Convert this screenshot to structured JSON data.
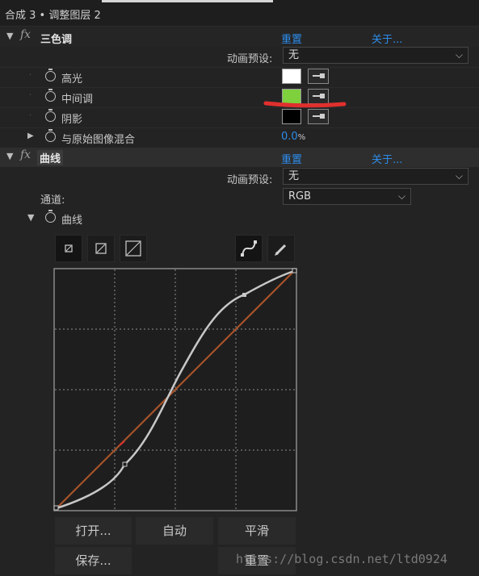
{
  "panel": {
    "title": "合成 3 • 调整图层 2"
  },
  "tritone": {
    "name": "三色调",
    "reset_label": "重置",
    "about_label": "关于...",
    "preset_label": "动画预设:",
    "preset_value": "无",
    "params": [
      {
        "label": "高光",
        "color": "#ffffff"
      },
      {
        "label": "中间调",
        "color": "#7ed03c"
      },
      {
        "label": "阴影",
        "color": "#000000"
      }
    ],
    "blend_label": "与原始图像混合",
    "blend_value": "0.0",
    "blend_unit": "%"
  },
  "curves": {
    "name": "曲线",
    "reset_label": "重置",
    "about_label": "关于...",
    "preset_label": "动画预设:",
    "preset_value": "无",
    "channel_label": "通道:",
    "channel_value": "RGB",
    "curve_label": "曲线",
    "buttons": {
      "open": "打开...",
      "auto": "自动",
      "smooth": "平滑",
      "save": "保存...",
      "reset": "重置"
    }
  },
  "annotation": {
    "underline_color": "#e0302e"
  },
  "watermark": "https://blog.csdn.net/ltd0924"
}
